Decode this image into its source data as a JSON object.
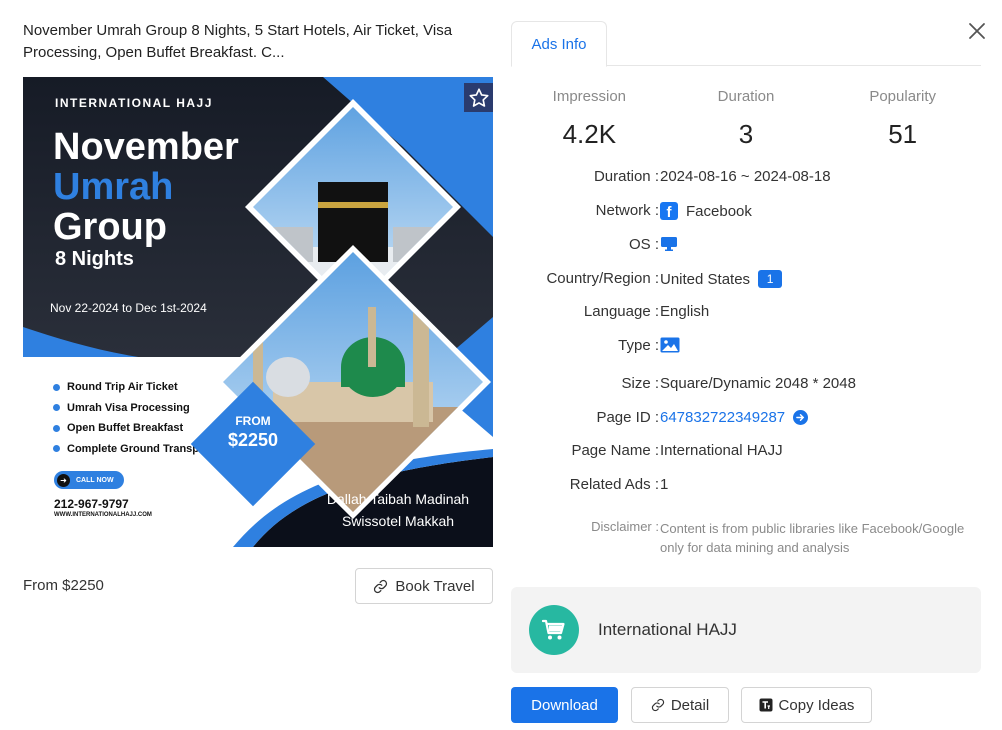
{
  "ad": {
    "title": "November Umrah Group 8 Nights, 5 Start Hotels, Air Ticket, Visa Processing, Open Buffet Breakfast. C...",
    "price_text": "From $2250",
    "book_button": "Book Travel"
  },
  "creative": {
    "brand": "INTERNATIONAL HAJJ",
    "headline_1": "November",
    "headline_2": "Umrah",
    "headline_3": "Group",
    "headline_4": "8 Nights",
    "dates": "Nov 22-2024 to Dec 1st-2024",
    "bullets": [
      "Round Trip Air Ticket",
      "Umrah Visa Processing",
      "Open Buffet Breakfast",
      "Complete Ground Transport"
    ],
    "from_label": "FROM",
    "from_price": "$2250",
    "call_now": "CALL NOW",
    "phone": "212-967-9797",
    "website": "WWW.INTERNATIONALHAJJ.COM",
    "hotel_1": "Dallah Taibah Madinah",
    "hotel_2": "Swissotel Makkah"
  },
  "tabs": {
    "active": "Ads Info"
  },
  "stats": [
    {
      "label": "Impression",
      "value": "4.2K"
    },
    {
      "label": "Duration",
      "value": "3"
    },
    {
      "label": "Popularity",
      "value": "51"
    }
  ],
  "info": {
    "duration_label": "Duration :",
    "duration_value": "2024-08-16 ~ 2024-08-18",
    "network_label": "Network :",
    "network_value": "Facebook",
    "os_label": "OS :",
    "os_icon": "monitor-icon",
    "country_label": "Country/Region :",
    "country_value": "United States",
    "country_count": "1",
    "language_label": "Language :",
    "language_value": "English",
    "type_label": "Type :",
    "type_icon": "image-icon",
    "size_label": "Size :",
    "size_value": "Square/Dynamic 2048 * 2048",
    "page_id_label": "Page ID :",
    "page_id_value": "647832722349287",
    "page_name_label": "Page Name :",
    "page_name_value": "International HAJJ",
    "related_label": "Related Ads :",
    "related_value": "1",
    "disclaimer_label": "Disclaimer :",
    "disclaimer_text": "Content is from public libraries like Facebook/Google only for data mining and analysis"
  },
  "advertiser": {
    "name": "International HAJJ"
  },
  "actions": {
    "download": "Download",
    "detail": "Detail",
    "copy_ideas": "Copy Ideas"
  },
  "colors": {
    "accent": "#1a73e8",
    "facebook": "#1877f2",
    "avatar": "#27b8a1",
    "creative_blue": "#2f80e0",
    "creative_dark": "#0b0f1a"
  }
}
